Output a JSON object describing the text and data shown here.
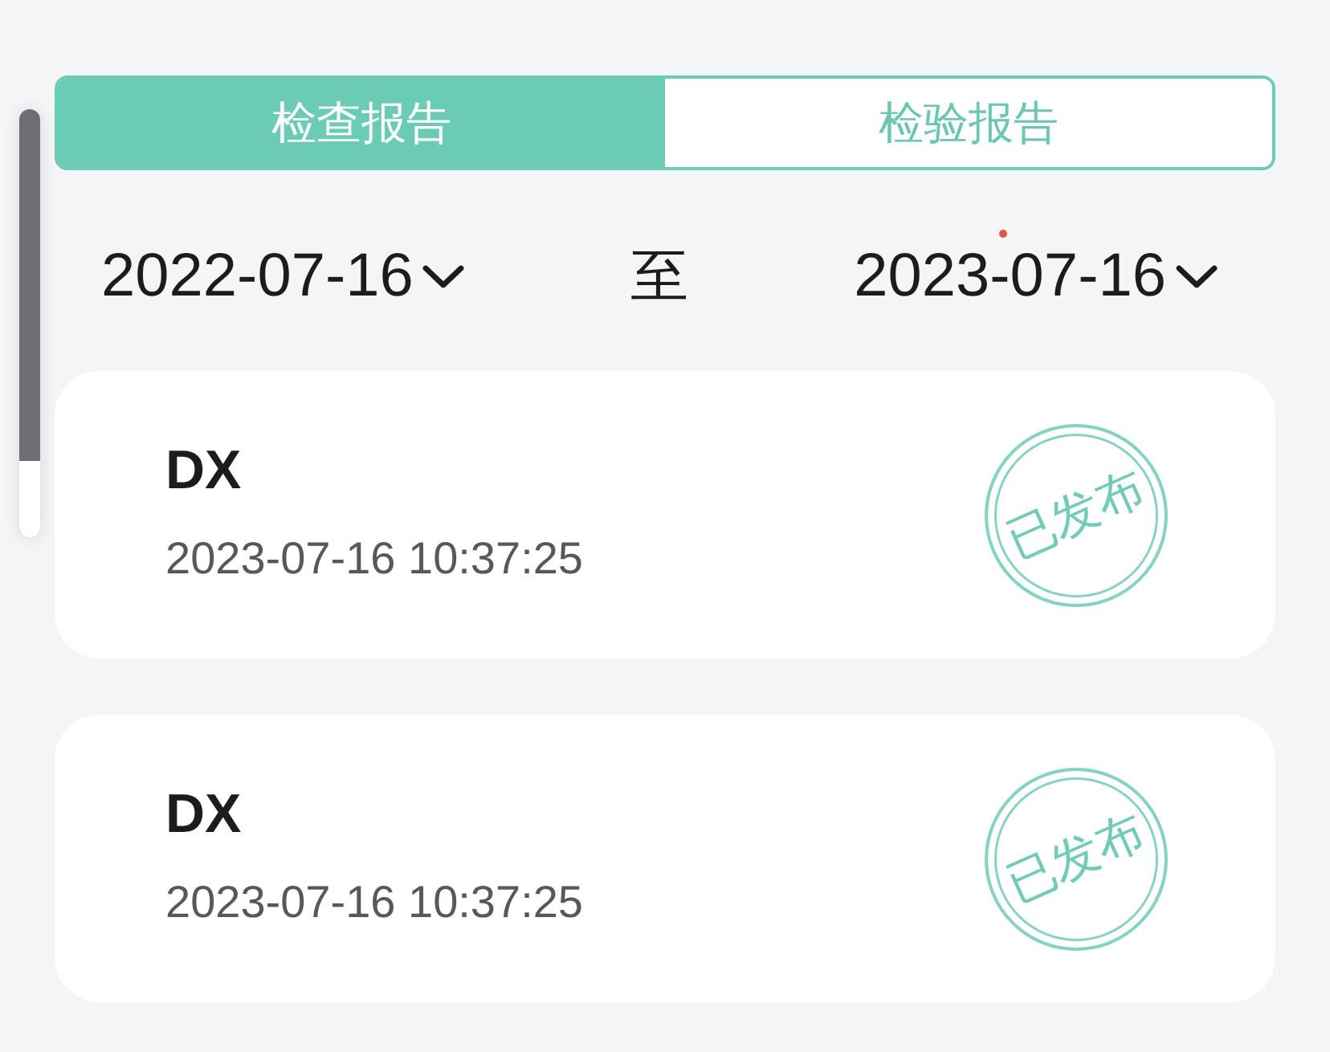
{
  "volume_indicator": {
    "level": 0.18
  },
  "tabs": [
    {
      "label": "检查报告",
      "selected": true
    },
    {
      "label": "检验报告",
      "selected": false
    }
  ],
  "date_range": {
    "start": "2022-07-16",
    "separator": "至",
    "end": "2023-07-16"
  },
  "reports": [
    {
      "title": "DX",
      "time": "2023-07-16 10:37:25",
      "status": "已发布"
    },
    {
      "title": "DX",
      "time": "2023-07-16 10:37:25",
      "status": "已发布"
    }
  ]
}
